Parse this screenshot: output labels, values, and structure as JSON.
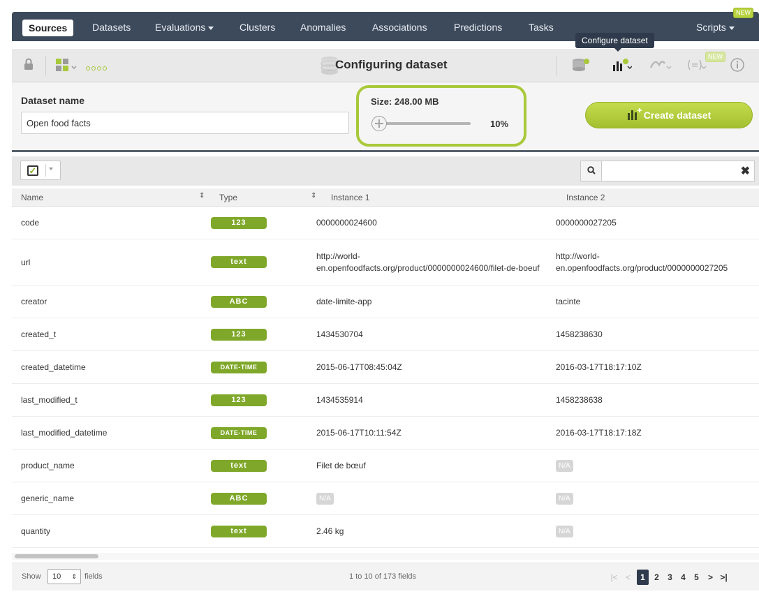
{
  "nav": {
    "tabs": [
      {
        "label": "Sources",
        "active": true
      },
      {
        "label": "Datasets"
      },
      {
        "label": "Evaluations"
      },
      {
        "label": "Clusters"
      },
      {
        "label": "Anomalies"
      },
      {
        "label": "Associations"
      },
      {
        "label": "Predictions"
      },
      {
        "label": "Tasks"
      }
    ],
    "scripts_label": "Scripts",
    "new_badge": "NEW"
  },
  "toolbar": {
    "title": "Configuring dataset",
    "tooltip": "Configure dataset",
    "new_badge": "NEW",
    "icons": [
      "lock-icon",
      "field-types-icon",
      "dots-icon",
      "database-icon",
      "configure-dataset-icon",
      "model-icon",
      "formula-icon",
      "info-icon"
    ]
  },
  "config": {
    "name_label": "Dataset name",
    "name_value": "Open food facts",
    "size_label": "Size: 248.00 MB",
    "sample_percent": "10%",
    "create_label": "Create dataset"
  },
  "table": {
    "columns": [
      "Name",
      "Type",
      "Instance 1",
      "Instance 2"
    ],
    "rows": [
      {
        "name": "code",
        "type": "123",
        "i1": "0000000024600",
        "i2": "0000000027205"
      },
      {
        "name": "url",
        "type": "text",
        "i1": "http://world-en.openfoodfacts.org/product/0000000024600/filet-de-boeuf",
        "i2": "http://world-en.openfoodfacts.org/product/0000000027205"
      },
      {
        "name": "creator",
        "type": "ABC",
        "i1": "date-limite-app",
        "i2": "tacinte"
      },
      {
        "name": "created_t",
        "type": "123",
        "i1": "1434530704",
        "i2": "1458238630"
      },
      {
        "name": "created_datetime",
        "type": "DATE-TIME",
        "i1": "2015-06-17T08:45:04Z",
        "i2": "2016-03-17T18:17:10Z"
      },
      {
        "name": "last_modified_t",
        "type": "123",
        "i1": "1434535914",
        "i2": "1458238638"
      },
      {
        "name": "last_modified_datetime",
        "type": "DATE-TIME",
        "i1": "2015-06-17T10:11:54Z",
        "i2": "2016-03-17T18:17:18Z"
      },
      {
        "name": "product_name",
        "type": "text",
        "i1": "Filet de bœuf",
        "i2": "N/A"
      },
      {
        "name": "generic_name",
        "type": "ABC",
        "i1": "N/A",
        "i2": "N/A"
      },
      {
        "name": "quantity",
        "type": "text",
        "i1": "2.46 kg",
        "i2": "N/A"
      }
    ]
  },
  "footer": {
    "show_label": "Show",
    "page_size": "10",
    "fields_label": "fields",
    "range_text": "1 to 10 of 173 fields",
    "pages": [
      "1",
      "2",
      "3",
      "4",
      "5"
    ],
    "current_page": "1",
    "first_icon": "|<",
    "prev_icon": "<",
    "next_icon": ">",
    "last_icon": ">|"
  },
  "colors": {
    "nav_bg": "#3d4a5c",
    "accent_green": "#a9c93b",
    "badge_green": "#7fa82a"
  }
}
